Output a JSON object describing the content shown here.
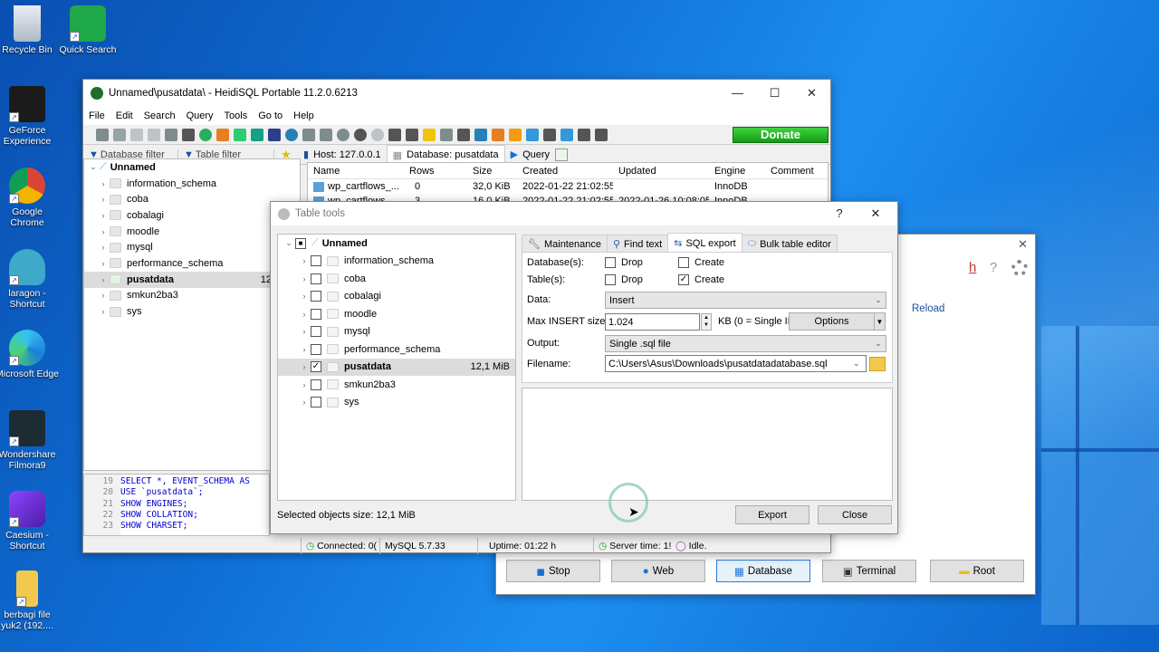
{
  "desktop_icons": [
    {
      "label": "Recycle Bin",
      "icon": "recycle-bin-icon"
    },
    {
      "label": "Quick Search",
      "icon": "quick-search-icon"
    },
    {
      "label": "GeForce Experience",
      "icon": "geforce-icon"
    },
    {
      "label": "Google Chrome",
      "icon": "chrome-icon"
    },
    {
      "label": "laragon - Shortcut",
      "icon": "laragon-icon"
    },
    {
      "label": "Microsoft Edge",
      "icon": "edge-icon"
    },
    {
      "label": "Wondershare Filmora9",
      "icon": "filmora-icon"
    },
    {
      "label": "Caesium - Shortcut",
      "icon": "caesium-icon"
    },
    {
      "label": "berbagi file yuk2 (192....",
      "icon": "folder-icon"
    }
  ],
  "heidi": {
    "title": "Unnamed\\pusatdata\\ - HeidiSQL Portable 11.2.0.6213",
    "minimize": "—",
    "maximize": "☐",
    "close": "✕",
    "menu": [
      "File",
      "Edit",
      "Search",
      "Query",
      "Tools",
      "Go to",
      "Help"
    ],
    "donate": "Donate",
    "filter_db": "Database filter",
    "filter_table": "Table filter",
    "tab_host": "Host: 127.0.0.1",
    "tab_database": "Database: pusatdata",
    "tab_query": "Query",
    "tree_root": "Unnamed",
    "tree": [
      "information_schema",
      "coba",
      "cobalagi",
      "moodle",
      "mysql",
      "performance_schema",
      "pusatdata",
      "smkun2ba3",
      "sys"
    ],
    "tree_size": "12,",
    "columns": [
      "Name",
      "Rows",
      "Size",
      "Created",
      "Updated",
      "Engine",
      "Comment"
    ],
    "rows": [
      {
        "name": "wp_cartflows_...",
        "rows": "0",
        "size": "32,0 KiB",
        "created": "2022-01-22 21:02:55",
        "updated": "",
        "engine": "InnoDB",
        "comment": ""
      },
      {
        "name": "wp_cartflows_...",
        "rows": "3",
        "size": "16,0 KiB",
        "created": "2022-01-22 21:02:55",
        "updated": "2022-01-26 10:08:05",
        "engine": "InnoDB",
        "comment": ""
      }
    ],
    "log": [
      {
        "n": "19",
        "text": "SELECT *, EVENT_SCHEMA AS"
      },
      {
        "n": "20",
        "text": "USE `pusatdata`;"
      },
      {
        "n": "21",
        "text": "SHOW ENGINES;"
      },
      {
        "n": "22",
        "text": "SHOW COLLATION;"
      },
      {
        "n": "23",
        "text": "SHOW CHARSET;"
      }
    ],
    "status": {
      "connected": "Connected: 0(",
      "mysql": "MySQL 5.7.33",
      "uptime": "Uptime: 01:22 h",
      "server": "Server time: 1!",
      "idle": "Idle."
    }
  },
  "tabletools": {
    "title": "Table tools",
    "help": "?",
    "close": "✕",
    "tree_root": "Unnamed",
    "tree": [
      "information_schema",
      "coba",
      "cobalagi",
      "moodle",
      "mysql",
      "performance_schema",
      "pusatdata",
      "smkun2ba3",
      "sys"
    ],
    "tree_size": "12,1 MiB",
    "tabs": [
      "Maintenance",
      "Find text",
      "SQL export",
      "Bulk table editor"
    ],
    "labels": {
      "databases": "Database(s):",
      "tables": "Table(s):",
      "data": "Data:",
      "max_insert": "Max INSERT size:",
      "output": "Output:",
      "filename": "Filename:"
    },
    "drop": "Drop",
    "create": "Create",
    "data_value": "Insert",
    "max_insert_value": "1.024",
    "kb_note": "KB (0 = Single IN",
    "options": "Options",
    "output_value": "Single .sql file",
    "filename_value": "C:\\Users\\Asus\\Downloads\\pusatdatadatabase.sql",
    "selected_size": "Selected objects size: 12,1 MiB",
    "export": "Export",
    "close_btn": "Close"
  },
  "laragon": {
    "close": "✕",
    "help": "?",
    "reload": "Reload",
    "h": "h",
    "buttons": [
      "Stop",
      "Web",
      "Database",
      "Terminal",
      "Root"
    ]
  }
}
